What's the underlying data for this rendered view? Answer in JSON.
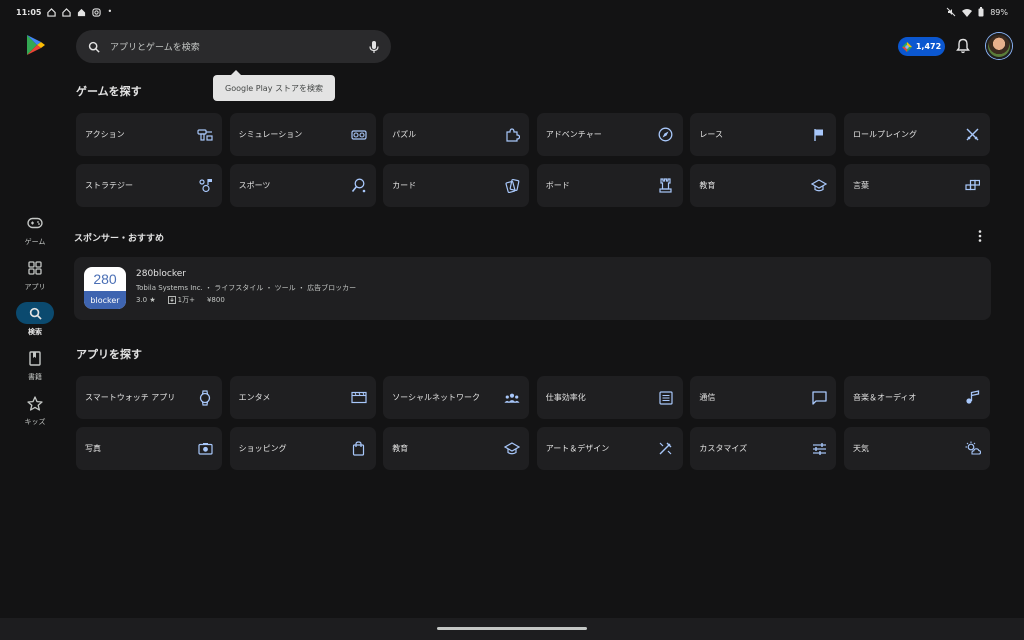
{
  "status_bar": {
    "time": "11:05",
    "left_icons": [
      "home-outline-icon",
      "home-outline-icon",
      "home-filled-icon",
      "instagram-icon"
    ],
    "dot": "•",
    "battery": "89%"
  },
  "rail": {
    "items": [
      {
        "label": "ゲーム",
        "icon": "gamepad-icon",
        "active": false
      },
      {
        "label": "アプリ",
        "icon": "apps-grid-icon",
        "active": false
      },
      {
        "label": "検索",
        "icon": "search-icon",
        "active": true
      },
      {
        "label": "書籍",
        "icon": "book-icon",
        "active": false
      },
      {
        "label": "キッズ",
        "icon": "star-icon",
        "active": false
      }
    ]
  },
  "search": {
    "placeholder": "アプリとゲームを検索",
    "tooltip": "Google Play ストアを検索"
  },
  "header": {
    "points": "1,472"
  },
  "games": {
    "title": "ゲームを探す",
    "categories": [
      {
        "label": "アクション",
        "icon": "action-icon"
      },
      {
        "label": "シミュレーション",
        "icon": "vr-goggles-icon"
      },
      {
        "label": "パズル",
        "icon": "puzzle-icon"
      },
      {
        "label": "アドベンチャー",
        "icon": "compass-icon"
      },
      {
        "label": "レース",
        "icon": "flag-icon"
      },
      {
        "label": "ロールプレイング",
        "icon": "swords-icon"
      },
      {
        "label": "ストラテジー",
        "icon": "strategy-icon"
      },
      {
        "label": "スポーツ",
        "icon": "sports-icon"
      },
      {
        "label": "カード",
        "icon": "cards-icon"
      },
      {
        "label": "ボード",
        "icon": "chess-rook-icon"
      },
      {
        "label": "教育",
        "icon": "school-cap-icon"
      },
      {
        "label": "言葉",
        "icon": "word-blocks-icon"
      }
    ]
  },
  "sponsored": {
    "title": "スポンサー・おすすめ",
    "app": {
      "icon_text_top": "280",
      "icon_text_bottom": "blocker",
      "name": "280blocker",
      "subtitle": "Tobila Systems Inc. ・ ライフスタイル ・ ツール ・ 広告ブロッカー",
      "rating": "3.0 ★",
      "downloads": "1万+",
      "price": "¥800"
    }
  },
  "apps": {
    "title": "アプリを探す",
    "categories": [
      {
        "label": "スマートウォッチ アプリ",
        "icon": "watch-icon"
      },
      {
        "label": "エンタメ",
        "icon": "clapper-icon"
      },
      {
        "label": "ソーシャルネットワーク",
        "icon": "people-icon"
      },
      {
        "label": "仕事効率化",
        "icon": "document-list-icon"
      },
      {
        "label": "通信",
        "icon": "chat-bubble-icon"
      },
      {
        "label": "音楽＆オーディオ",
        "icon": "music-note-icon"
      },
      {
        "label": "写真",
        "icon": "camera-icon"
      },
      {
        "label": "ショッピング",
        "icon": "shopping-bag-icon"
      },
      {
        "label": "教育",
        "icon": "school-cap-icon"
      },
      {
        "label": "アート＆デザイン",
        "icon": "brush-icon"
      },
      {
        "label": "カスタマイズ",
        "icon": "sliders-icon"
      },
      {
        "label": "天気",
        "icon": "weather-sun-cloud-icon"
      }
    ]
  },
  "colors": {
    "background": "#131314",
    "card": "#1f1f21",
    "accent": "#0b57d0",
    "active_nav": "#0b4a6f"
  }
}
